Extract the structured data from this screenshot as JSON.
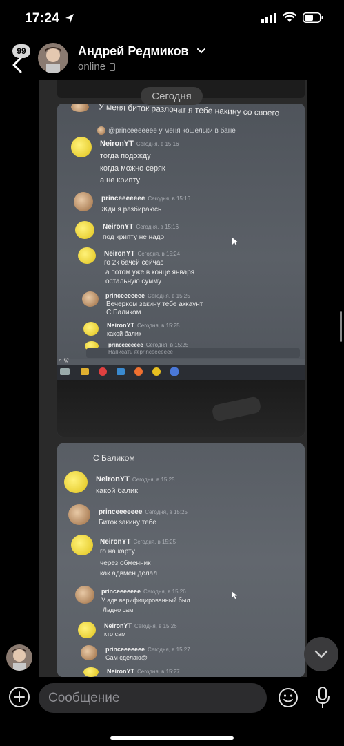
{
  "status_bar": {
    "time": "17:24"
  },
  "header": {
    "back_badge": "99",
    "contact_name": "Андрей Редмиков",
    "contact_status": "online"
  },
  "date_divider": "Сегодня",
  "photo1": {
    "top_line": "У меня биток разлочат я тебе накину со своего",
    "reply_quote": "@princeeeeeee у меня кошельки в бане",
    "messages": [
      {
        "user": "NeironYT",
        "time": "Сегодня, в 15:16",
        "lines": [
          "тогда подожду",
          "когда можно серяк",
          "а не крипту"
        ]
      },
      {
        "user": "princeeeeeee",
        "time": "Сегодня, в 15:16",
        "lines": [
          "Жди я разбираюсь"
        ]
      },
      {
        "user": "NeironYT",
        "time": "Сегодня, в 15:16",
        "lines": [
          "под крипту не надо"
        ]
      },
      {
        "user": "NeironYT",
        "time": "Сегодня, в 15:24",
        "lines": [
          "го 2к бачей сейчас",
          "а потом уже в конце января",
          "остальную сумму"
        ]
      },
      {
        "user": "princeeeeeee",
        "time": "Сегодня, в 15:25",
        "lines": [
          "Вечерком закину тебе аккаунт",
          "С Баликом"
        ]
      },
      {
        "user": "NeironYT",
        "time": "Сегодня, в 15:25",
        "lines": [
          "какой балик"
        ]
      },
      {
        "user": "princeeeeeee",
        "time": "Сегодня, в 15:25",
        "lines": []
      }
    ],
    "compose_placeholder": "Написать @princeeeeeee"
  },
  "photo2": {
    "top_line": "С Баликом",
    "messages": [
      {
        "user": "NeironYT",
        "time": "Сегодня, в 15:25",
        "lines": [
          "какой балик"
        ]
      },
      {
        "user": "princeeeeeee",
        "time": "Сегодня, в 15:25",
        "lines": [
          "Биток закину тебе"
        ]
      },
      {
        "user": "NeironYT",
        "time": "Сегодня, в 15:25",
        "lines": [
          "го на карту",
          "через обменник",
          "как адвмен делал"
        ]
      },
      {
        "user": "princeeeeeee",
        "time": "Сегодня, в 15:26",
        "lines": [
          "У адв верифицированный был",
          "Ладно сам"
        ]
      },
      {
        "user": "NeironYT",
        "time": "Сегодня, в 15:26",
        "lines": [
          "кто сам"
        ]
      },
      {
        "user": "princeeeeeee",
        "time": "Сегодня, в 15:27",
        "lines": [
          "Сам сделаю@"
        ]
      },
      {
        "user": "NeironYT",
        "time": "Сегодня, в 15:27",
        "lines": []
      }
    ]
  },
  "composer": {
    "placeholder": "Сообщение"
  },
  "colors": {
    "background": "#000000",
    "input_bg": "#2c2c2e",
    "column_bg": "#2a2a2a"
  }
}
